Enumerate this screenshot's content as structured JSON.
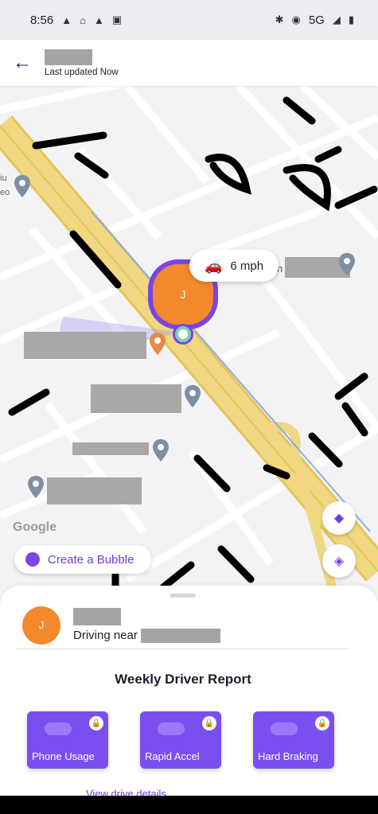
{
  "status_bar": {
    "time": "8:56",
    "network": "5G",
    "left_icons": [
      "navigation-icon",
      "home-icon",
      "navigation-icon",
      "screenshot-icon"
    ],
    "right_icons": [
      "bluetooth-icon",
      "location-icon",
      "signal-icon",
      "battery-icon"
    ]
  },
  "header": {
    "subtitle": "Last updated Now"
  },
  "map": {
    "speed": "6 mph",
    "marker_initial": "J",
    "attribution": "Google",
    "street_fragments": [
      "iu",
      "eo",
      "n"
    ],
    "create_bubble_label": "Create a Bubble",
    "colors": {
      "highway": "#f0d782",
      "highway_edge": "#e6c35a",
      "road": "#ffffff",
      "route": "#8aaee6",
      "marker_ring": "#7a45e6",
      "marker_fill": "#f3892c"
    }
  },
  "sheet": {
    "member_initial": "J",
    "driving_prefix": "Driving near",
    "report_title": "Weekly Driver Report",
    "cards": [
      {
        "label": "Phone Usage"
      },
      {
        "label": "Rapid Accel"
      },
      {
        "label": "Hard Braking"
      }
    ],
    "link_partial": "View drive details"
  }
}
